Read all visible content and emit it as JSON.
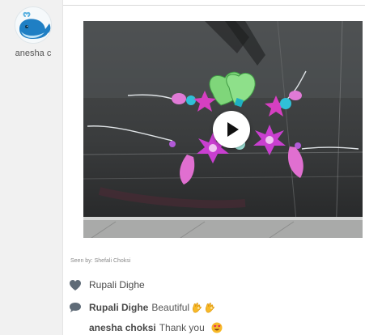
{
  "post": {
    "author_name": "anesha c",
    "avatar_icon": "whale-icon",
    "play_icon": "play-icon"
  },
  "seen_by": {
    "label": "Seen by:",
    "names": "Shefali Choksi"
  },
  "likes": [
    {
      "icon": "heart-icon",
      "name": "Rupali Dighe"
    }
  ],
  "comments": [
    {
      "icon": "comment-icon",
      "author": "Rupali Dighe",
      "text": "Beautiful",
      "emoji": [
        "ok-hand-emoji",
        "ok-hand-emoji"
      ]
    },
    {
      "author": "anesha choksi",
      "text": "Thank you",
      "emoji": [
        "heart-eyes-emoji"
      ]
    }
  ],
  "colors": {
    "sidebar_bg": "#f1f1f1",
    "accent_icon": "#5f6b77",
    "craft_pink": "#d63fc1",
    "craft_green": "#7fd67a",
    "craft_teal": "#3ec3d6"
  }
}
